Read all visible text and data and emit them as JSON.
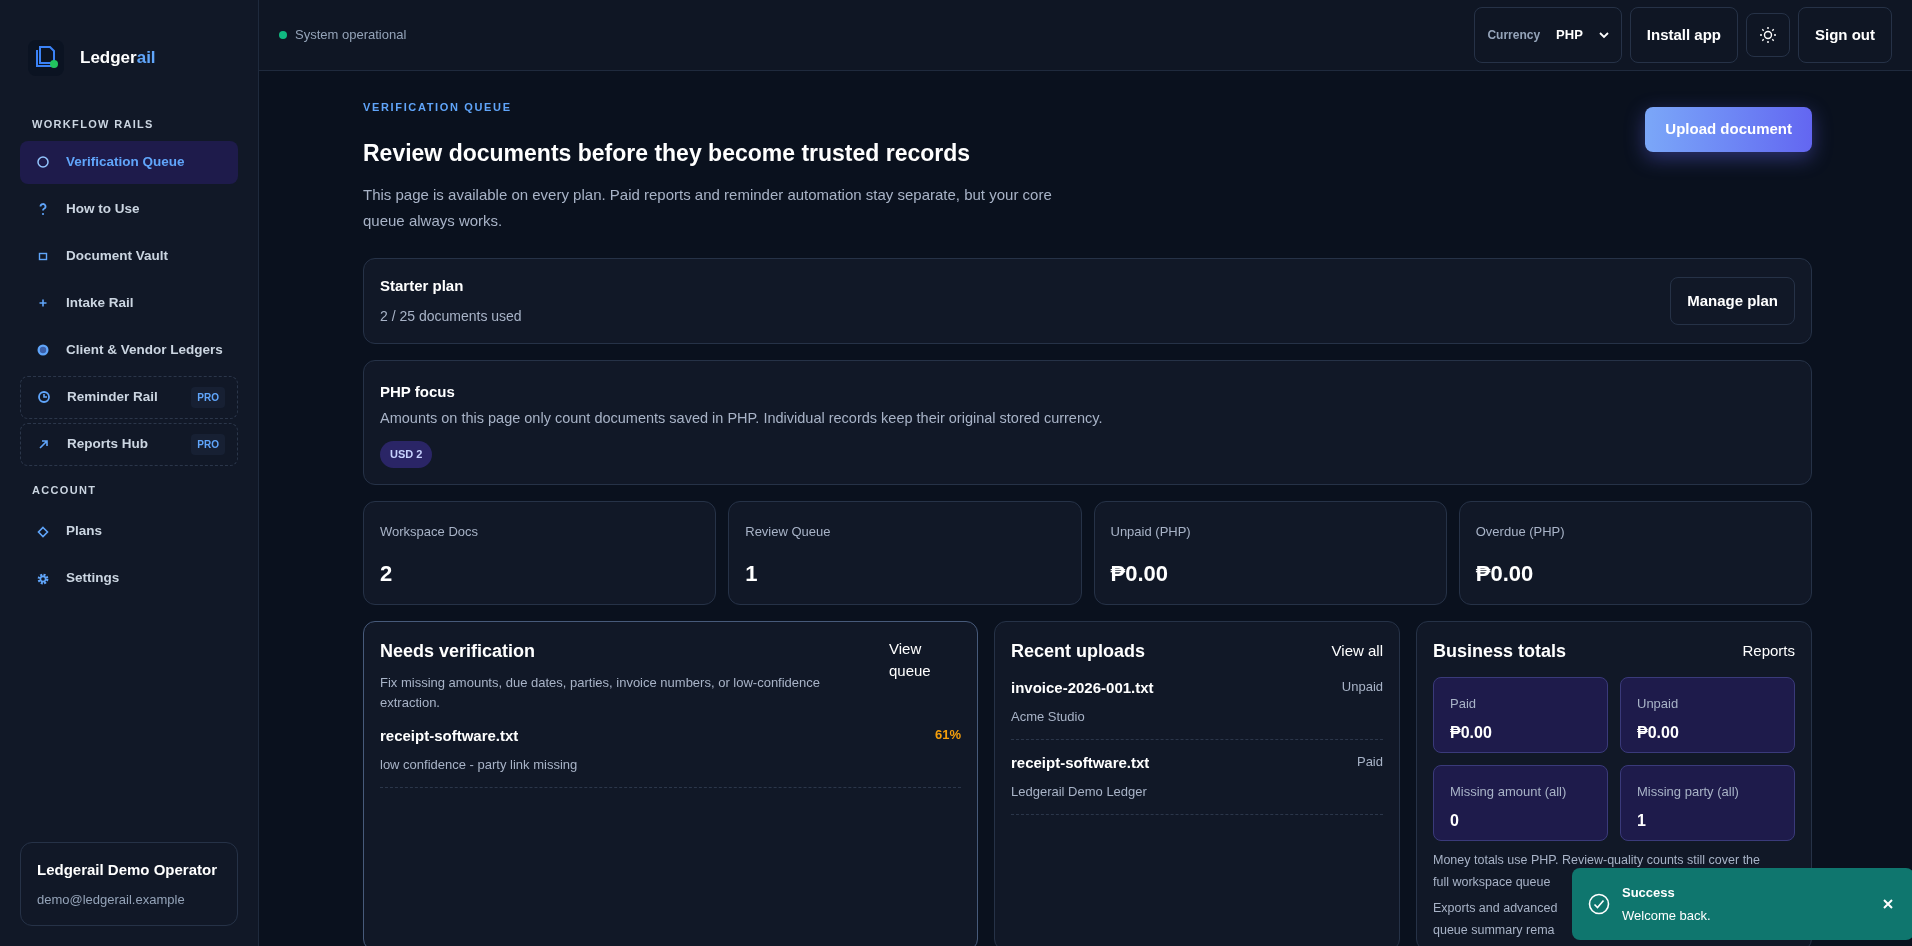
{
  "brand": {
    "name": "Ledger",
    "accent": "ail"
  },
  "sidebar": {
    "sections": [
      {
        "title": "WORKFLOW RAILS",
        "items": [
          {
            "label": "Verification Queue",
            "selected": true
          },
          {
            "label": "How to Use",
            "selected": false
          },
          {
            "label": "Document Vault",
            "selected": false
          },
          {
            "label": "Intake Rail",
            "selected": false
          },
          {
            "label": "Client & Vendor Ledgers",
            "selected": false
          },
          {
            "label": "Reminder Rail",
            "selected": false,
            "badge": "PRO"
          },
          {
            "label": "Reports Hub",
            "selected": false,
            "badge": "PRO"
          }
        ]
      },
      {
        "title": "ACCOUNT",
        "items": [
          {
            "label": "Plans",
            "selected": false
          },
          {
            "label": "Settings",
            "selected": false
          }
        ]
      }
    ],
    "user": {
      "name": "Ledgerail Demo Operator",
      "email": "demo@ledgerail.example"
    }
  },
  "topbar": {
    "status": "System operational",
    "currency_label": "Currency",
    "currency": "PHP",
    "buttons": [
      "Install app",
      "Sign out"
    ]
  },
  "header": {
    "eyebrow": "VERIFICATION QUEUE",
    "title": "Review documents before they become trusted records",
    "description": "This page is available on every plan. Paid reports and reminder automation stay separate, but your core queue always works.",
    "action": "Upload document"
  },
  "plan": {
    "title": "Starter plan",
    "usage": "2 / 25 documents used",
    "action": "Manage plan"
  },
  "focus": {
    "title": "PHP focus",
    "text": "Amounts on this page only count documents saved in PHP. Individual records keep their original stored currency.",
    "tags": [
      "USD 2"
    ]
  },
  "stats": [
    {
      "label": "Workspace Docs",
      "value": "2"
    },
    {
      "label": "Review Queue",
      "value": "1"
    },
    {
      "label": "Unpaid (PHP)",
      "value": "₱0.00"
    },
    {
      "label": "Overdue (PHP)",
      "value": "₱0.00"
    }
  ],
  "needs_verification": {
    "title": "Needs verification",
    "link": "View queue",
    "description": "Fix missing amounts, due dates, parties, invoice numbers, or low-confidence extraction.",
    "items": [
      {
        "name": "receipt-software.txt",
        "note": "low confidence - party link missing",
        "score": "61%"
      }
    ]
  },
  "recent_uploads": {
    "title": "Recent uploads",
    "link": "View all",
    "items": [
      {
        "name": "invoice-2026-001.txt",
        "party": "Acme Studio",
        "status": "Unpaid"
      },
      {
        "name": "receipt-software.txt",
        "party": "Ledgerail Demo Ledger",
        "status": "Paid"
      }
    ]
  },
  "business_totals": {
    "title": "Business totals",
    "link": "Reports",
    "tiles": [
      {
        "label": "Paid",
        "value": "₱0.00"
      },
      {
        "label": "Unpaid",
        "value": "₱0.00"
      },
      {
        "label": "Missing amount (all)",
        "value": "0"
      },
      {
        "label": "Missing party (all)",
        "value": "1"
      }
    ],
    "notes": [
      "Money totals use PHP. Review-quality counts still cover the",
      "full workspace queue",
      "Exports and advanced",
      "queue summary rema"
    ]
  },
  "toast": {
    "title": "Success",
    "message": "Welcome back."
  }
}
